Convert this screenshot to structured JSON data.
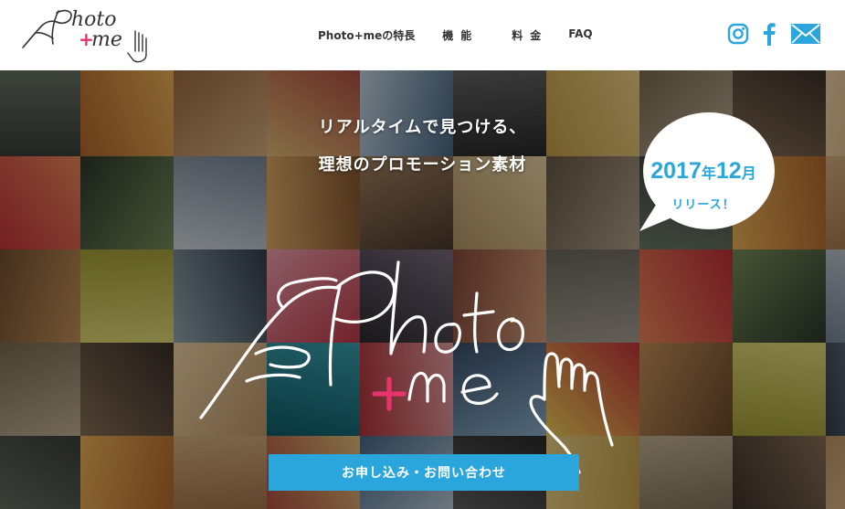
{
  "header": {
    "logo_text": "Photo+me",
    "nav": [
      {
        "label": "Photo+meの特長"
      },
      {
        "label": "機能"
      },
      {
        "label": "料金"
      },
      {
        "label": "FAQ"
      }
    ],
    "social": [
      "instagram-icon",
      "facebook-icon",
      "mail-icon"
    ]
  },
  "hero": {
    "catch_line1": "リアルタイムで見つける、",
    "catch_line2": "理想のプロモーション素材",
    "wordmark": "Photo+me",
    "bubble": {
      "year_num": "2017",
      "year_unit": "年",
      "month_num": "12",
      "month_unit": "月",
      "release": "リリース！"
    },
    "cta_label": "お申し込み・お問い合わせ"
  },
  "colors": {
    "accent_blue": "#2aa6dc",
    "accent_pink": "#e8336d",
    "icon_blue": "#2aa6dc"
  }
}
